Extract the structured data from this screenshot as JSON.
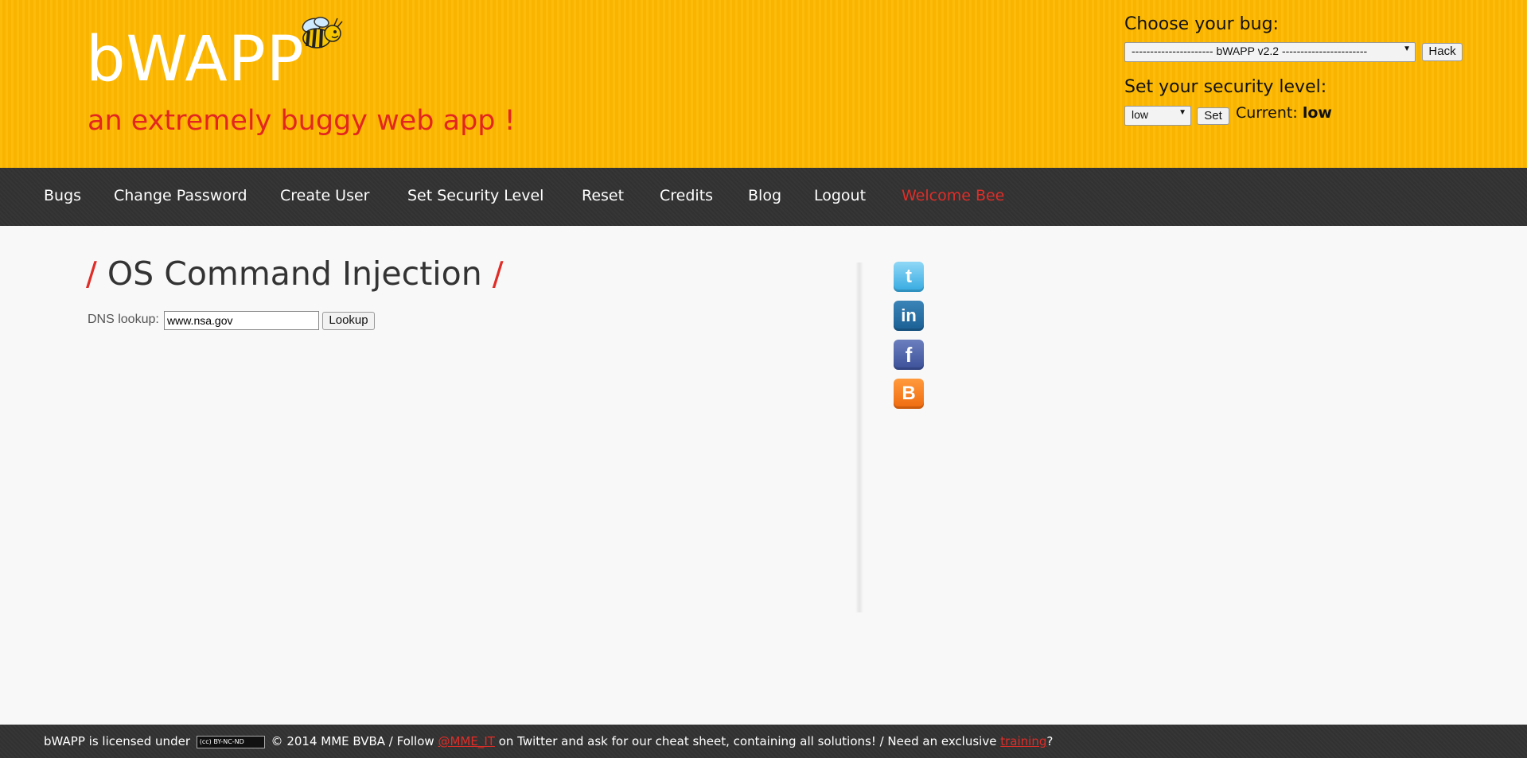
{
  "header": {
    "logo": "bWAPP",
    "tagline": "an extremely buggy web app !",
    "choose_bug_label": "Choose your bug:",
    "bug_select_value": "---------------------- bWAPP v2.2 -----------------------",
    "hack_button": "Hack",
    "security_label": "Set your security level:",
    "security_select_value": "low",
    "set_button": "Set",
    "current_label": "Current:",
    "current_value": "low"
  },
  "nav": {
    "items": [
      "Bugs",
      "Change Password",
      "Create User",
      "Set Security Level",
      "Reset",
      "Credits",
      "Blog",
      "Logout"
    ],
    "welcome": "Welcome Bee"
  },
  "main": {
    "title": "OS Command Injection",
    "slash": "/",
    "dns_label": "DNS lookup:",
    "dns_value": "www.nsa.gov",
    "lookup_button": "Lookup"
  },
  "social": {
    "twitter": "t",
    "linkedin": "in",
    "facebook": "f",
    "blogger": "B"
  },
  "footer": {
    "text1": "bWAPP is licensed under",
    "cc_badge": "(cc) BY-NC-ND",
    "text2": "© 2014 MME BVBA / Follow",
    "twitter_link": "@MME_IT",
    "text3": "on Twitter and ask for our cheat sheet, containing all solutions! / Need an exclusive",
    "training_link": "training",
    "text4": "?"
  },
  "colors": {
    "header_bg": "#fdb800",
    "nav_bg": "#333333",
    "accent_red": "#e02d28"
  }
}
